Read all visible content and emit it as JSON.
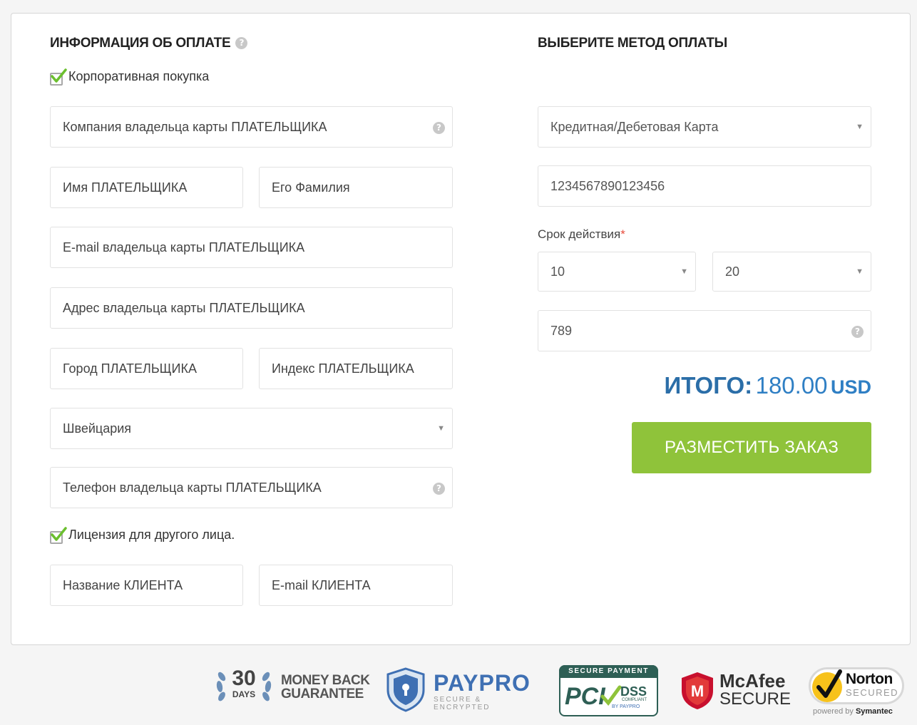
{
  "billing": {
    "title": "ИНФОРМАЦИЯ ОБ ОПЛАТЕ",
    "corporate_label": "Корпоративная покупка",
    "company_placeholder": "Компания владельца карты ПЛАТЕЛЬЩИКА",
    "first_name_placeholder": "Имя ПЛАТЕЛЬЩИКА",
    "last_name_placeholder": "Его Фамилия",
    "email_placeholder": "E-mail владельца карты ПЛАТЕЛЬЩИКА",
    "address_placeholder": "Адрес владельца карты ПЛАТЕЛЬЩИКА",
    "city_placeholder": "Город ПЛАТЕЛЬЩИКА",
    "zip_placeholder": "Индекс ПЛАТЕЛЬЩИКА",
    "country_value": "Швейцария",
    "phone_placeholder": "Телефон владельца карты ПЛАТЕЛЬЩИКА",
    "license_label": "Лицензия для другого лица.",
    "client_name_placeholder": "Название КЛИЕНТА",
    "client_email_placeholder": "E-mail КЛИЕНТА"
  },
  "payment": {
    "title": "ВЫБЕРИТЕ МЕТОД ОПЛАТЫ",
    "method_value": "Кредитная/Дебетовая Карта",
    "card_number_value": "1234567890123456",
    "expiry_label": "Срок действия",
    "expiry_required_mark": "*",
    "expiry_month_value": "10",
    "expiry_year_value": "20",
    "cvv_value": "789",
    "total_word": "ИТОГО:",
    "total_amount": "180.00",
    "total_currency": "USD",
    "order_button": "РАЗМЕСТИТЬ ЗАКАЗ"
  },
  "badges": {
    "guarantee_days_number": "30",
    "guarantee_days_word": "DAYS",
    "guarantee_line1": "MONEY BACK",
    "guarantee_line2": "GUARANTEE",
    "paypro_name": "PAYPRO",
    "paypro_tagline": "SECURE & ENCRYPTED",
    "pci_header": "SECURE PAYMENT",
    "pci_main": "PCI",
    "pci_dss": "DSS",
    "pci_compliant": "COMPLIANT",
    "pci_by": "BY PAYPRO",
    "mcafee_name": "McAfee",
    "mcafee_secure": "SECURE",
    "norton_name": "Norton",
    "norton_secured": "SECURED",
    "norton_powered_prefix": "powered by",
    "norton_powered_brand": "Symantec"
  },
  "colors": {
    "accent_green": "#8fc33a",
    "total_blue": "#2f7fc4",
    "check_green": "#6bbf2e"
  }
}
